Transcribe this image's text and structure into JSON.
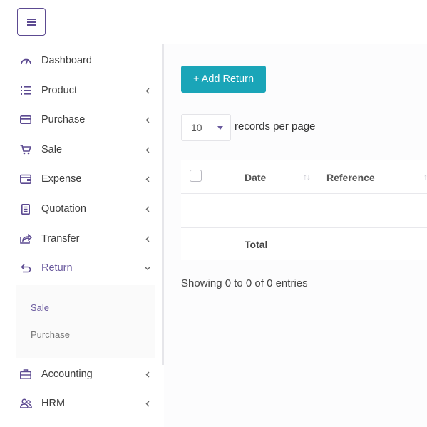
{
  "topbar": {
    "menu_icon": "hamburger-icon"
  },
  "sidebar": {
    "items": [
      {
        "label": "Dashboard",
        "icon": "gauge-icon",
        "has_chevron": false
      },
      {
        "label": "Product",
        "icon": "list-icon",
        "has_chevron": true
      },
      {
        "label": "Purchase",
        "icon": "card-icon",
        "has_chevron": true
      },
      {
        "label": "Sale",
        "icon": "cart-icon",
        "has_chevron": true
      },
      {
        "label": "Expense",
        "icon": "wallet-icon",
        "has_chevron": true
      },
      {
        "label": "Quotation",
        "icon": "document-icon",
        "has_chevron": true
      },
      {
        "label": "Transfer",
        "icon": "share-icon",
        "has_chevron": true
      },
      {
        "label": "Return",
        "icon": "return-icon",
        "has_chevron": true,
        "expanded": true
      },
      {
        "label": "Accounting",
        "icon": "briefcase-icon",
        "has_chevron": true
      },
      {
        "label": "HRM",
        "icon": "users-icon",
        "has_chevron": true
      }
    ],
    "return_submenu": [
      {
        "label": "Sale"
      },
      {
        "label": "Purchase"
      }
    ]
  },
  "main": {
    "add_button_label": "+ Add Return",
    "records_per_page": {
      "value": "10",
      "label": "records per page"
    },
    "table": {
      "columns": [
        "Date",
        "Reference"
      ],
      "footer_total": "Total"
    },
    "showing_text": "Showing 0 to 0 of 0 entries"
  },
  "colors": {
    "accent": "#6a5a9e",
    "button": "#1aa5b8"
  }
}
